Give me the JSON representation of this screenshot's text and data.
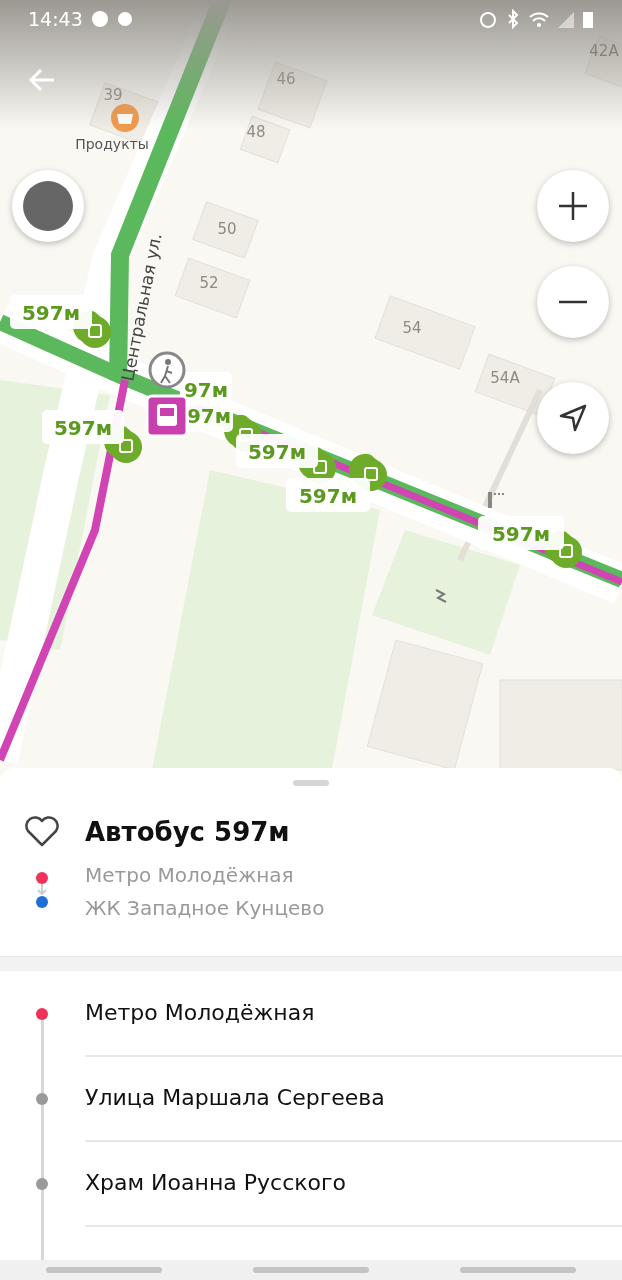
{
  "status_bar": {
    "time": "14:43"
  },
  "map": {
    "street_label": "Центральная ул.",
    "poi": {
      "label": "Продукты"
    },
    "house_numbers": [
      "42А",
      "39",
      "46",
      "48",
      "50",
      "52",
      "54",
      "54А"
    ],
    "route_labels": [
      "597м",
      "97м",
      "97м",
      "597м",
      "597м",
      "597м",
      "597м"
    ]
  },
  "route": {
    "title": "Автобус 597м",
    "favorite": false,
    "from": {
      "name": "Метро Молодёжная",
      "color": "#f0325a"
    },
    "to": {
      "name": "ЖК Западное Кунцево",
      "color": "#1f6fd6"
    }
  },
  "stops": [
    {
      "name": "Метро Молодёжная",
      "color": "#f0325a"
    },
    {
      "name": "Улица Маршала Сергеева",
      "color": "#9a9a9a"
    },
    {
      "name": "Храм Иоанна Русского",
      "color": "#9a9a9a"
    }
  ]
}
